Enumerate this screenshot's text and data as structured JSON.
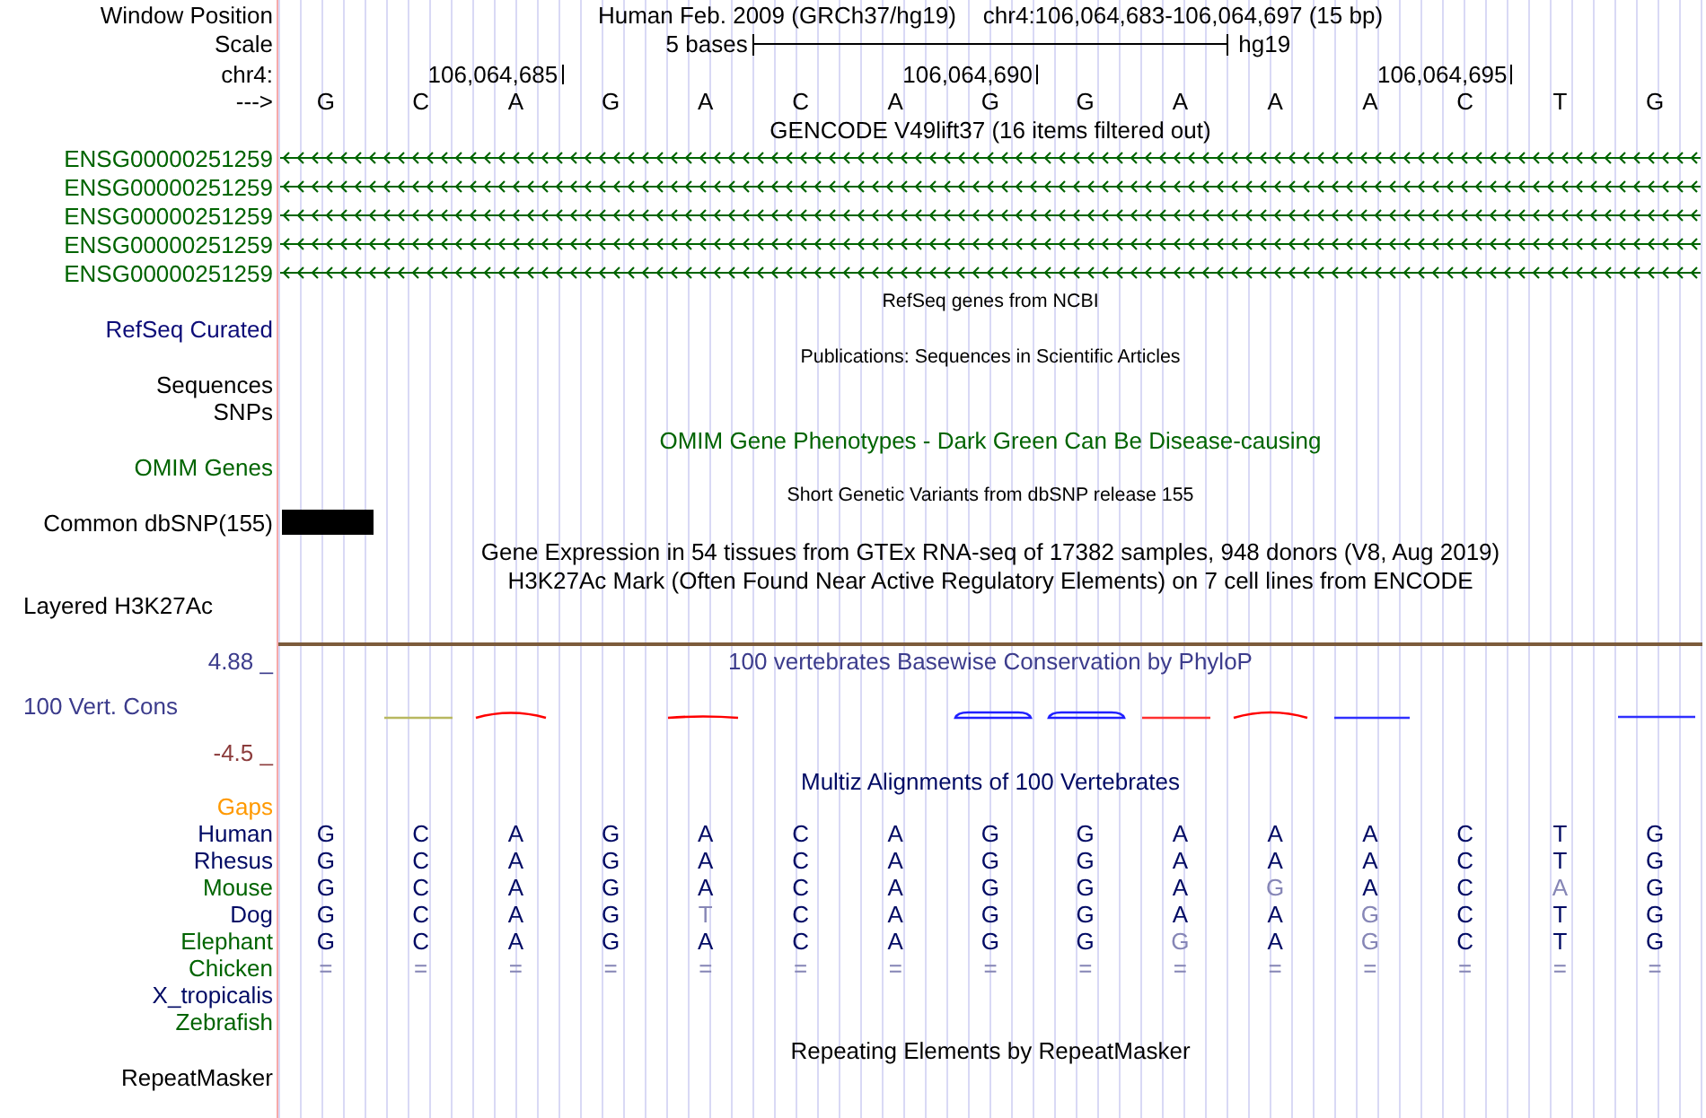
{
  "position": {
    "label": "Window Position",
    "assembly": "Human Feb. 2009 (GRCh37/hg19)",
    "range": "chr4:106,064,683-106,064,697 (15 bp)"
  },
  "scale": {
    "label": "Scale",
    "length": "5 bases",
    "database": "hg19"
  },
  "ruler": {
    "label": "chr4:",
    "ticks": [
      "106,064,685",
      "106,064,690",
      "106,064,695"
    ]
  },
  "sequence": {
    "label": "--->",
    "bases": [
      "G",
      "C",
      "A",
      "G",
      "A",
      "C",
      "A",
      "G",
      "G",
      "A",
      "A",
      "A",
      "C",
      "T",
      "G"
    ]
  },
  "tracks": [
    {
      "kind": "genes",
      "title": "GENCODE V49lift37 (16 items filtered out)",
      "color": "#000000",
      "items": [
        {
          "label": "ENSG00000251259",
          "color": "#006400",
          "reverse_strand": true
        },
        {
          "label": "ENSG00000251259",
          "color": "#006400",
          "reverse_strand": true
        },
        {
          "label": "ENSG00000251259",
          "color": "#006400",
          "reverse_strand": true
        },
        {
          "label": "ENSG00000251259",
          "color": "#006400",
          "reverse_strand": true
        },
        {
          "label": "ENSG00000251259",
          "color": "#006400",
          "reverse_strand": true
        }
      ]
    },
    {
      "kind": "composite",
      "title": "RefSeq genes from NCBI",
      "color": "#000000",
      "subtracks": [
        {
          "label": "RefSeq Curated",
          "color": "#0c0c78",
          "feature_block": false
        }
      ]
    },
    {
      "kind": "composite",
      "title": "Publications: Sequences in Scientific Articles",
      "color": "#000000",
      "subtracks": [
        {
          "label": "Sequences",
          "color": "#000000",
          "feature_block": false
        },
        {
          "label": "SNPs",
          "color": "#000000",
          "feature_block": false
        }
      ]
    },
    {
      "kind": "simple",
      "title": "OMIM Gene Phenotypes - Dark Green Can Be Disease-causing",
      "color": "#006400",
      "label": "OMIM Genes"
    },
    {
      "kind": "composite",
      "title": "Short Genetic Variants from dbSNP release 155",
      "color": "#000000",
      "subtracks": [
        {
          "label": "Common dbSNP(155)",
          "color": "#000000",
          "feature_block": true
        }
      ]
    },
    {
      "kind": "simple",
      "title": "Gene Expression in 54 tissues from GTEx RNA-seq of 17382 samples, 948 donors (V8, Aug 2019)",
      "color": "#000000"
    },
    {
      "kind": "graph",
      "title": "H3K27Ac Mark (Often Found Near Active Regulatory Elements) on 7 cell lines from ENCODE",
      "color": "#000000",
      "label": "Layered H3K27Ac"
    },
    {
      "kind": "wiggle",
      "title": "100 vertebrates Basewise Conservation by PhyloP",
      "color": "#3c3c8c",
      "label": "100 Vert. Cons",
      "max": {
        "text": "4.88 _",
        "color": "#3c3c8c"
      },
      "min": {
        "text": "-4.5 _",
        "color": "#8c3c3c"
      }
    },
    {
      "kind": "alignment",
      "title": "Multiz Alignments of 100 Vertebrates",
      "color": "#000a64",
      "gaps": {
        "label": "Gaps",
        "color": "#ff9900"
      },
      "species": [
        {
          "name": "Human",
          "color": "#000a64",
          "bases": [
            {
              "base": "G",
              "dimmed": false
            },
            {
              "base": "C",
              "dimmed": false
            },
            {
              "base": "A",
              "dimmed": false
            },
            {
              "base": "G",
              "dimmed": false
            },
            {
              "base": "A",
              "dimmed": false
            },
            {
              "base": "C",
              "dimmed": false
            },
            {
              "base": "A",
              "dimmed": false
            },
            {
              "base": "G",
              "dimmed": false
            },
            {
              "base": "G",
              "dimmed": false
            },
            {
              "base": "A",
              "dimmed": false
            },
            {
              "base": "A",
              "dimmed": false
            },
            {
              "base": "A",
              "dimmed": false
            },
            {
              "base": "C",
              "dimmed": false
            },
            {
              "base": "T",
              "dimmed": false
            },
            {
              "base": "G",
              "dimmed": false
            }
          ]
        },
        {
          "name": "Rhesus",
          "color": "#000a64",
          "bases": [
            {
              "base": "G",
              "dimmed": false
            },
            {
              "base": "C",
              "dimmed": false
            },
            {
              "base": "A",
              "dimmed": false
            },
            {
              "base": "G",
              "dimmed": false
            },
            {
              "base": "A",
              "dimmed": false
            },
            {
              "base": "C",
              "dimmed": false
            },
            {
              "base": "A",
              "dimmed": false
            },
            {
              "base": "G",
              "dimmed": false
            },
            {
              "base": "G",
              "dimmed": false
            },
            {
              "base": "A",
              "dimmed": false
            },
            {
              "base": "A",
              "dimmed": false
            },
            {
              "base": "A",
              "dimmed": false
            },
            {
              "base": "C",
              "dimmed": false
            },
            {
              "base": "T",
              "dimmed": false
            },
            {
              "base": "G",
              "dimmed": false
            }
          ]
        },
        {
          "name": "Mouse",
          "color": "#006400",
          "bases": [
            {
              "base": "G",
              "dimmed": false
            },
            {
              "base": "C",
              "dimmed": false
            },
            {
              "base": "A",
              "dimmed": false
            },
            {
              "base": "G",
              "dimmed": false
            },
            {
              "base": "A",
              "dimmed": false
            },
            {
              "base": "C",
              "dimmed": false
            },
            {
              "base": "A",
              "dimmed": false
            },
            {
              "base": "G",
              "dimmed": false
            },
            {
              "base": "G",
              "dimmed": false
            },
            {
              "base": "A",
              "dimmed": false
            },
            {
              "base": "G",
              "dimmed": true
            },
            {
              "base": "A",
              "dimmed": false
            },
            {
              "base": "C",
              "dimmed": false
            },
            {
              "base": "A",
              "dimmed": true
            },
            {
              "base": "G",
              "dimmed": false
            }
          ]
        },
        {
          "name": "Dog",
          "color": "#000a64",
          "bases": [
            {
              "base": "G",
              "dimmed": false
            },
            {
              "base": "C",
              "dimmed": false
            },
            {
              "base": "A",
              "dimmed": false
            },
            {
              "base": "G",
              "dimmed": false
            },
            {
              "base": "T",
              "dimmed": true
            },
            {
              "base": "C",
              "dimmed": false
            },
            {
              "base": "A",
              "dimmed": false
            },
            {
              "base": "G",
              "dimmed": false
            },
            {
              "base": "G",
              "dimmed": false
            },
            {
              "base": "A",
              "dimmed": false
            },
            {
              "base": "A",
              "dimmed": false
            },
            {
              "base": "G",
              "dimmed": true
            },
            {
              "base": "C",
              "dimmed": false
            },
            {
              "base": "T",
              "dimmed": false
            },
            {
              "base": "G",
              "dimmed": false
            }
          ]
        },
        {
          "name": "Elephant",
          "color": "#006400",
          "bases": [
            {
              "base": "G",
              "dimmed": false
            },
            {
              "base": "C",
              "dimmed": false
            },
            {
              "base": "A",
              "dimmed": false
            },
            {
              "base": "G",
              "dimmed": false
            },
            {
              "base": "A",
              "dimmed": false
            },
            {
              "base": "C",
              "dimmed": false
            },
            {
              "base": "A",
              "dimmed": false
            },
            {
              "base": "G",
              "dimmed": false
            },
            {
              "base": "G",
              "dimmed": false
            },
            {
              "base": "G",
              "dimmed": true
            },
            {
              "base": "A",
              "dimmed": false
            },
            {
              "base": "G",
              "dimmed": true
            },
            {
              "base": "C",
              "dimmed": false
            },
            {
              "base": "T",
              "dimmed": false
            },
            {
              "base": "G",
              "dimmed": false
            }
          ]
        },
        {
          "name": "Chicken",
          "color": "#006400",
          "bases": [
            {
              "base": "=",
              "dimmed": true
            },
            {
              "base": "=",
              "dimmed": true
            },
            {
              "base": "=",
              "dimmed": true
            },
            {
              "base": "=",
              "dimmed": true
            },
            {
              "base": "=",
              "dimmed": true
            },
            {
              "base": "=",
              "dimmed": true
            },
            {
              "base": "=",
              "dimmed": true
            },
            {
              "base": "=",
              "dimmed": true
            },
            {
              "base": "=",
              "dimmed": true
            },
            {
              "base": "=",
              "dimmed": true
            },
            {
              "base": "=",
              "dimmed": true
            },
            {
              "base": "=",
              "dimmed": true
            },
            {
              "base": "=",
              "dimmed": true
            },
            {
              "base": "=",
              "dimmed": true
            },
            {
              "base": "=",
              "dimmed": true
            }
          ]
        },
        {
          "name": "X_tropicalis",
          "color": "#000a64"
        },
        {
          "name": "Zebrafish",
          "color": "#006400"
        }
      ]
    },
    {
      "kind": "simple",
      "title": "Repeating Elements by RepeatMasker",
      "color": "#000000",
      "label": "RepeatMasker"
    }
  ]
}
